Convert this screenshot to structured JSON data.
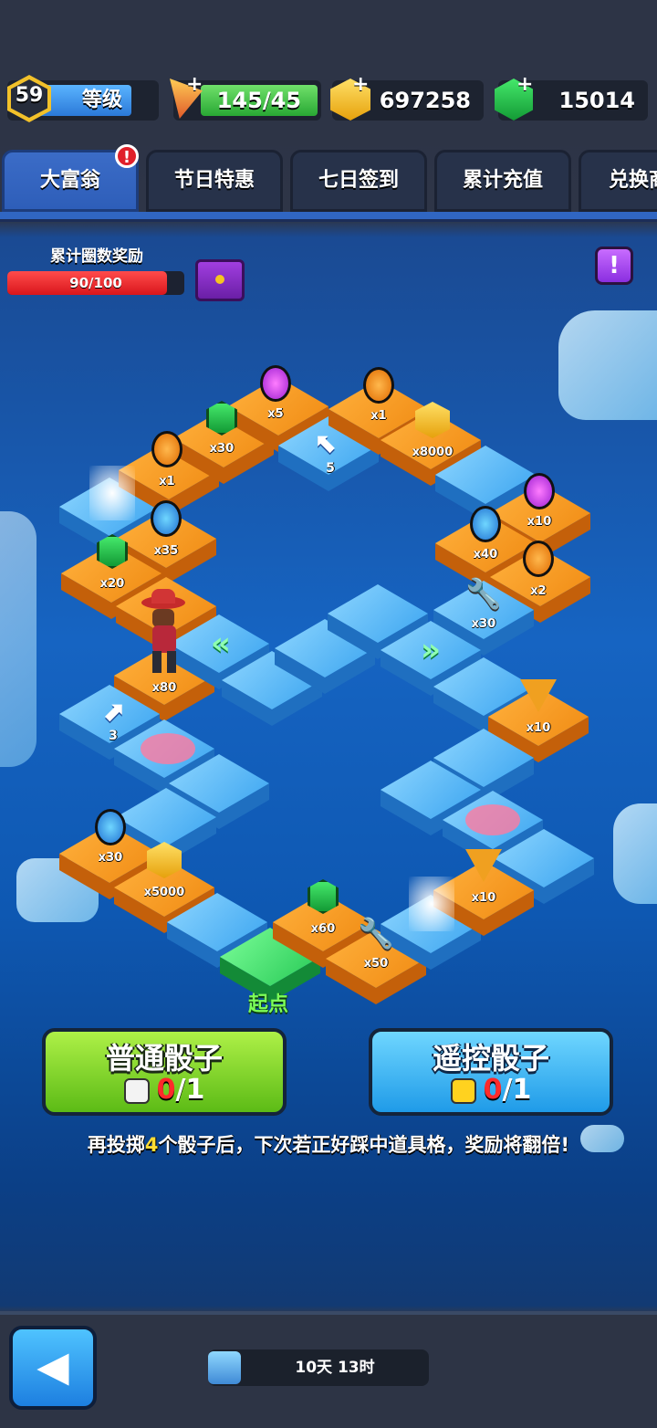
{
  "header": {
    "level": {
      "value": "59",
      "label": "等级"
    },
    "energy": {
      "value": "145/45"
    },
    "coins": {
      "value": "697258"
    },
    "gems": {
      "value": "15014"
    }
  },
  "tabs": [
    {
      "label": "大富翁",
      "active": true,
      "badge": "!"
    },
    {
      "label": "节日特惠"
    },
    {
      "label": "七日签到"
    },
    {
      "label": "累计充值"
    },
    {
      "label": "兑换商"
    }
  ],
  "lap_reward": {
    "title": "累计圈数奖励",
    "progress_text": "90/100",
    "progress_fraction": 0.9
  },
  "info_button": "!",
  "board": {
    "start_label": "起点",
    "quantities": {
      "q1": "x5",
      "q2": "x1",
      "q3": "x30",
      "q4": "x1",
      "q5": "x8000",
      "q6": "x35",
      "q7": "x10",
      "q8": "x20",
      "q9": "x40",
      "q10": "x2",
      "q11": "x30",
      "q12": "x80",
      "q13": "x10",
      "q14": "x30",
      "q15": "x5000",
      "q16": "x10",
      "q17": "x60",
      "q18": "x50"
    },
    "arrow_steps": {
      "a1": "5",
      "a2": "3"
    }
  },
  "dice": {
    "normal": {
      "title": "普通骰子",
      "current": "0",
      "total": "/1"
    },
    "remote": {
      "title": "遥控骰子",
      "current": "0",
      "total": "/1"
    }
  },
  "hint": {
    "prefix": "再投掷",
    "number": "4",
    "suffix": "个骰子后，下次若正好踩中道具格，奖励将翻倍!"
  },
  "footer": {
    "timer": "10天 13时",
    "back_icon": "back-arrow-icon"
  },
  "colors": {
    "accent_blue": "#3b6cc7",
    "progress_red": "#e0202a",
    "green_button": "#7fd21f",
    "blue_button": "#38b8f5"
  }
}
